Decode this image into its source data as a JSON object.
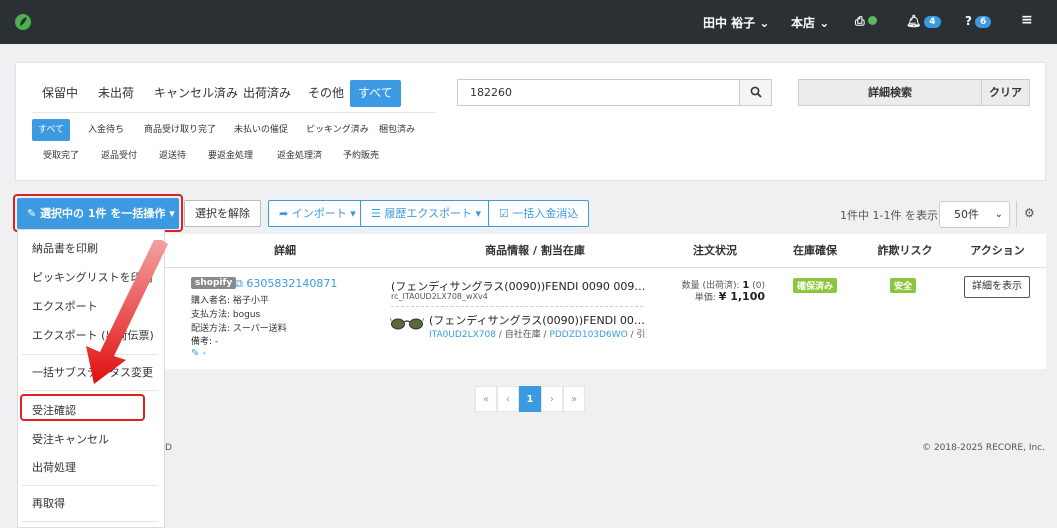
{
  "topbar": {
    "user": "田中 裕子",
    "store": "本店",
    "notifications": "4",
    "help_count": "6"
  },
  "status_tabs": [
    "保留中",
    "未出荷",
    "キャンセル済み",
    "出荷済み",
    "その他",
    "すべて"
  ],
  "sub_tabs_row1": [
    "すべて",
    "入金待ち",
    "商品受け取り完了",
    "未払いの催促",
    "ピッキング済み",
    "梱包済み"
  ],
  "sub_tabs_row2": [
    "受取完了",
    "返品受付",
    "返送待",
    "要返金処理",
    "返金処理済",
    "予約販売"
  ],
  "search": {
    "value": "182260",
    "advanced": "詳細検索",
    "clear": "クリア"
  },
  "toolbar": {
    "bulk": "選択中の 1件 を一括操作",
    "deselect": "選択を解除",
    "import": "インポート",
    "history_export": "履歴エクスポート",
    "bulk_payment": "一括入金消込",
    "count": "1件中 1-1件 を表示",
    "per_page": "50件"
  },
  "table": {
    "headers": [
      "詳細",
      "商品情報 / 割当在庫",
      "注文状況",
      "在庫確保",
      "詐欺リスク",
      "アクション"
    ],
    "row": {
      "shop": "shopify",
      "order_no": "6305832140871",
      "buyer": "購入者名: 裕子小平",
      "payment": "支払方法: bogus",
      "delivery": "配送方法: スーパー送料",
      "note": "備考: -",
      "edit": "-",
      "product": "(フェンディサングラス(0090))FENDI 0090 0090 D3O/...",
      "sku": "rc_ITA0UD2LX708_wXv4",
      "product2": "(フェンディサングラス(0090))FENDI 0090 009...",
      "stock_sku": "ITA0UD2LX708",
      "stock_mid": " / 自社在庫 / ",
      "stock_code": "PDDZD103D6WO",
      "stock_tail": " / 引当...",
      "qty_label": "数量 (出荷済):",
      "qty_value": "1",
      "qty_shipped": "(0)",
      "price_label": "単価:",
      "price_value": "¥ 1,100",
      "reserve": "確保済み",
      "fraud": "安全",
      "action": "詳細を表示"
    }
  },
  "pager": [
    "«",
    "‹",
    "1",
    "›",
    "»"
  ],
  "footer": {
    "copyright": "© 2018-2025 RECORE, Inc.",
    "left": "D"
  },
  "dropdown": {
    "items": [
      "納品書を印刷",
      "ピッキングリストを印刷",
      "エクスポート",
      "エクスポート (出荷伝票)",
      "一括サブステータス変更",
      "受注確認",
      "受注キャンセル",
      "出荷処理",
      "再取得"
    ]
  },
  "colors": {
    "accent": "#3b9ae1",
    "topbar": "#2b3035",
    "highlight": "#e02020",
    "green": "#8cc63f"
  }
}
